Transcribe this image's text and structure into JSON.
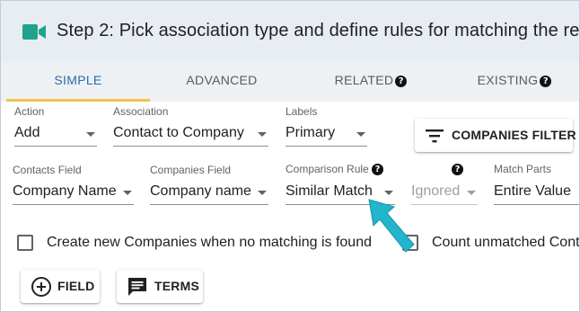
{
  "header": {
    "title": "Step 2: Pick association type and define rules for matching the re",
    "icon": "video-camera-icon",
    "accent": "#1fa38d"
  },
  "tabs": [
    {
      "label": "SIMPLE",
      "active": true
    },
    {
      "label": "ADVANCED"
    },
    {
      "label": "RELATED",
      "help": "?"
    },
    {
      "label": "EXISTING",
      "help": "?"
    }
  ],
  "row1": {
    "action": {
      "label": "Action",
      "value": "Add"
    },
    "association": {
      "label": "Association",
      "value": "Contact to Company"
    },
    "labels": {
      "label": "Labels",
      "value": "Primary"
    },
    "companies_filter": "COMPANIES FILTER"
  },
  "row2": {
    "contacts_field": {
      "label": "Contacts Field",
      "value": "Company Name"
    },
    "companies_field": {
      "label": "Companies Field",
      "value": "Company name"
    },
    "comparison_rule": {
      "label": "Comparison Rule",
      "value": "Similar Match"
    },
    "ignored": {
      "help": "?",
      "value": "Ignored"
    },
    "match_parts": {
      "label": "Match Parts",
      "value": "Entire Value"
    }
  },
  "checkboxes": {
    "create_new": "Create new Companies when no matching is found",
    "count_unmatched": "Count unmatched Cont"
  },
  "buttons": {
    "field": "FIELD",
    "terms": "TERMS"
  },
  "colors": {
    "header_bg": "#e8edf3",
    "active_tab": "#2a6ba8",
    "tab_underline": "#f0c24a",
    "pointer_arrow": "#22b5cc"
  }
}
